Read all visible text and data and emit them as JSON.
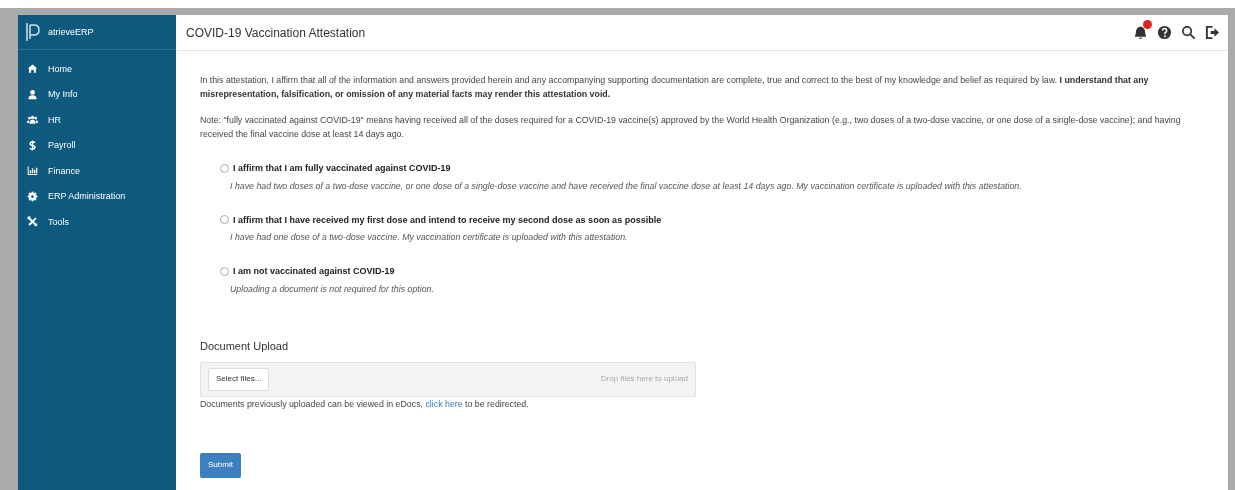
{
  "sidebar": {
    "brand": "atrieveERP",
    "items": [
      {
        "label": "Home"
      },
      {
        "label": "My Info"
      },
      {
        "label": "HR"
      },
      {
        "label": "Payroll"
      },
      {
        "label": "Finance"
      },
      {
        "label": "ERP Administration"
      },
      {
        "label": "Tools"
      }
    ]
  },
  "header": {
    "title": "COVID-19 Vaccination Attestation"
  },
  "intro": "In this attestation, I affirm that all of the information and answers provided herein and any accompanying supporting documentation are complete, true and correct to the best of my knowledge and belief as required by law. **I understand that any misrepresentation, falsification, or omission of any material facts may render this attestation void.**",
  "note": "Note: \"fully vaccinated against COVID-19\" means having received all of the doses required for a COVID-19 vaccine(s) approved by the World Health Organization (e.g., two doses of a two-dose vaccine, or one dose of a single-dose vaccine); and having received the final vaccine dose at least 14 days ago.",
  "options": [
    {
      "label": "I affirm that I am fully vaccinated against COVID-19",
      "description": "I have had two doses of a two-dose vaccine, or one dose of a single-dose vaccine and have received the final vaccine dose at least 14 days ago. My vaccination certificate is uploaded with this attestation.",
      "selected": false
    },
    {
      "label": "I affirm that I have received my first dose and intend to receive my second dose as soon as possible",
      "description": "I have had one dose of a two-dose vaccine. My vaccination certificate is uploaded with this attestation.",
      "selected": false
    },
    {
      "label": "I am not vaccinated against COVID-19",
      "description": "Uploading a document is not required for this option.",
      "selected": false
    }
  ],
  "upload": {
    "heading": "Document Upload",
    "select_button": "Select files...",
    "drop_hint": "Drop files here to upload",
    "info_before": "Documents previously uploaded can be viewed in eDocs,",
    "info_link": "click here",
    "info_after": "to be redirected."
  },
  "submit": "Submit"
}
